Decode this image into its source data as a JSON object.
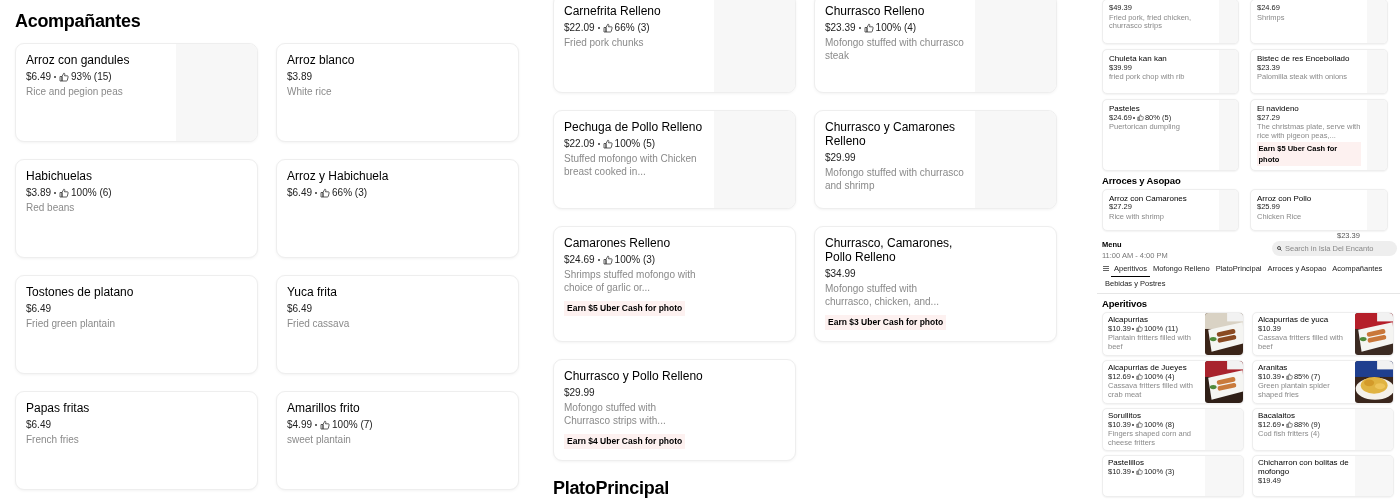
{
  "panels": [
    {
      "blocks": [
        {
          "kind": "heading",
          "text": "Acompañantes"
        },
        {
          "kind": "grid",
          "items": [
            {
              "kind": "placeholder",
              "title": "Arroz con gandules",
              "price": "$6.49",
              "rating": "93% (15)",
              "description": "Rice and pegion peas"
            },
            {
              "kind": "plain",
              "title": "Arroz blanco",
              "price": "$3.89",
              "description": "White rice"
            },
            {
              "kind": "plain",
              "title": "Habichuelas",
              "price": "$3.89",
              "rating": "100% (6)",
              "description": "Red beans"
            },
            {
              "kind": "plain",
              "title": "Arroz y Habichuela",
              "price": "$6.49",
              "rating": "66% (3)"
            },
            {
              "kind": "plain",
              "title": "Tostones de platano",
              "price": "$6.49",
              "description": "Fried green plantain"
            },
            {
              "kind": "plain",
              "title": "Yuca frita",
              "price": "$6.49",
              "description": "Fried cassava"
            },
            {
              "kind": "plain",
              "title": "Papas fritas",
              "price": "$6.49",
              "description": "French fries"
            },
            {
              "kind": "plain",
              "title": "Amarillos frito",
              "price": "$4.99",
              "rating": "100% (7)",
              "description": "sweet plantain"
            }
          ]
        }
      ]
    },
    {
      "blocks": [
        {
          "kind": "grid",
          "items": [
            {
              "kind": "placeholder",
              "title": "Carnefrita Relleno",
              "price": "$22.09",
              "rating": "66% (3)",
              "description": "Fried pork chunks"
            },
            {
              "kind": "placeholder",
              "title": "Churrasco Relleno",
              "price": "$23.39",
              "rating": "100% (4)",
              "description": "Mofongo stuffed with churrasco steak"
            },
            {
              "kind": "placeholder",
              "title": "Pechuga de Pollo Relleno",
              "price": "$22.09",
              "rating": "100% (5)",
              "description": "Stuffed mofongo with Chicken breast cooked in..."
            },
            {
              "kind": "placeholder",
              "title": "Churrasco y Camarones Relleno",
              "price": "$29.99",
              "description": "Mofongo stuffed with churrasco and shrimp"
            },
            {
              "kind": "plain",
              "title": "Camarones Relleno",
              "price": "$24.69",
              "rating": "100% (3)",
              "description": "Shrimps stuffed mofongo with choice of garlic or...",
              "badge": "Earn $5 Uber Cash for photo"
            },
            {
              "kind": "plain",
              "title": "Churrasco, Camarones, Pollo Relleno",
              "price": "$34.99",
              "description": "Mofongo stuffed with churrasco, chicken, and...",
              "badge": "Earn $3 Uber Cash for photo"
            },
            {
              "kind": "plain",
              "title": "Churrasco y Pollo Relleno",
              "price": "$29.99",
              "description": "Mofongo stuffed with Churrasco strips with...",
              "badge": "Earn $4 Uber Cash for photo"
            }
          ]
        },
        {
          "kind": "heading",
          "text": "PlatoPrincipal"
        }
      ]
    },
    {
      "blocks": [
        {
          "kind": "grid",
          "items": [
            {
              "kind": "placeholder",
              "price": "$49.39",
              "description": "Fried pork, fried chicken, churrasco strips"
            },
            {
              "kind": "placeholder",
              "price": "$24.69",
              "description": "Shrimps"
            },
            {
              "kind": "placeholder",
              "title": "Chuleta kan kan",
              "price": "$39.99",
              "description": "fried pork chop with rib"
            },
            {
              "kind": "placeholder",
              "title": "Bistec de res Encebollado",
              "price": "$23.39",
              "description": "Palomilla steak with onions"
            },
            {
              "kind": "placeholder",
              "title": "Pasteles",
              "price": "$24.69",
              "rating": "80% (5)",
              "description": "Puertorican dumpling"
            },
            {
              "kind": "placeholder",
              "title": "El navideno",
              "price": "$27.29",
              "description": "The christmas plate, serve with rice with pigeon peas,...",
              "badge": "Earn $5 Uber Cash for photo"
            }
          ]
        },
        {
          "kind": "heading",
          "text": "Arroces y Asopao"
        },
        {
          "kind": "grid",
          "items": [
            {
              "kind": "placeholder",
              "title": "Arroz con Camarones",
              "price": "$27.29",
              "description": "Rice with shrimp"
            },
            {
              "kind": "placeholder",
              "title": "Arroz con Pollo",
              "price": "$25.99",
              "description": "Chicken Rice"
            }
          ]
        },
        {
          "kind": "note",
          "text": "$23.39"
        },
        {
          "kind": "menu_header",
          "title": "Menu",
          "hours": "11:00 AM - 4:00 PM",
          "search": {
            "placeholder": "Search in Isla Del Encanto"
          },
          "tabs": [
            {
              "label": "Aperitivos",
              "selected": true
            },
            {
              "label": "Mofongo Relleno",
              "selected": false
            },
            {
              "label": "PlatoPrincipal",
              "selected": false
            },
            {
              "label": "Arroces y Asopao",
              "selected": false
            },
            {
              "label": "Acompañantes",
              "selected": false
            },
            {
              "label": "Bebidas y Postres",
              "selected": false
            }
          ]
        },
        {
          "kind": "heading",
          "text": "Aperitivos"
        },
        {
          "kind": "grid",
          "items": [
            {
              "title": "Alcapurrias",
              "price": "$10.39",
              "rating": "100% (11)",
              "description": "Plantain fritters filled with beef"
            },
            {
              "title": "Alcapurrias de yuca",
              "price": "$10.39",
              "description": "Cassava fritters filled with beef"
            },
            {
              "title": "Alcapurrias de Jueyes",
              "price": "$12.69",
              "rating": "100% (4)",
              "description": "Cassava fritters filled with crab meat"
            },
            {
              "title": "Aranitas",
              "price": "$10.39",
              "rating": "85% (7)",
              "description": "Green plantain spider shaped fries"
            },
            {
              "kind": "placeholder",
              "title": "Sorullitos",
              "price": "$10.39",
              "rating": "100% (8)",
              "description": "Fingers shaped corn and cheese fritters"
            },
            {
              "kind": "placeholder",
              "title": "Bacalaitos",
              "price": "$12.69",
              "rating": "88% (9)",
              "description": "Cod fish fritters (4)"
            },
            {
              "kind": "placeholder",
              "title": "Pastelillos",
              "price": "$10.39",
              "rating": "100% (3)"
            },
            {
              "kind": "placeholder",
              "title": "Chicharron con bolitas de mofongo",
              "price": "$19.49"
            }
          ]
        }
      ]
    }
  ]
}
